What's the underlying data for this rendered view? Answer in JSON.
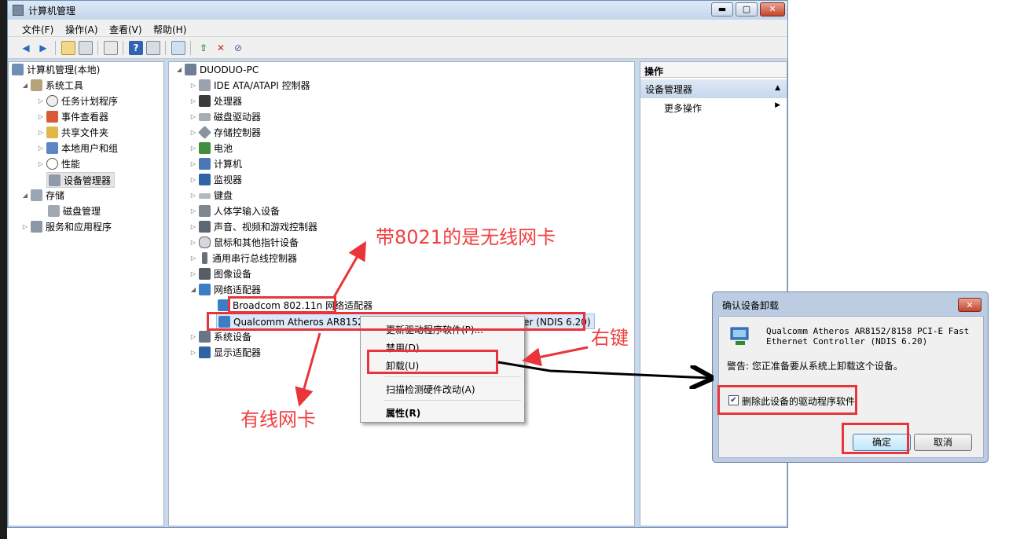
{
  "window": {
    "title": "计算机管理",
    "min_icon": "▬",
    "max_icon": "▢",
    "close_icon": "✕"
  },
  "menubar": [
    "文件(F)",
    "操作(A)",
    "查看(V)",
    "帮助(H)"
  ],
  "toolbar_icons": [
    "back-arrow-icon",
    "forward-arrow-icon",
    "up-folder-icon",
    "console-tree-icon",
    "properties-icon",
    "help-icon",
    "details-icon",
    "scan-icon",
    "update-driver-icon",
    "uninstall-icon",
    "disable-icon"
  ],
  "left_tree": {
    "root": "计算机管理(本地)",
    "system_tools": "系统工具",
    "items": [
      "任务计划程序",
      "事件查看器",
      "共享文件夹",
      "本地用户和组",
      "性能",
      "设备管理器"
    ],
    "storage": "存储",
    "disk": "磁盘管理",
    "services": "服务和应用程序"
  },
  "device_tree": {
    "root": "DUODUO-PC",
    "categories_a": [
      "IDE ATA/ATAPI 控制器",
      "处理器",
      "磁盘驱动器",
      "存储控制器",
      "电池",
      "计算机",
      "监视器",
      "键盘",
      "人体学输入设备",
      "声音、视频和游戏控制器",
      "鼠标和其他指针设备",
      "通用串行总线控制器",
      "图像设备"
    ],
    "network": "网络适配器",
    "wireless": "Broadcom 802.11n 网络适配器",
    "wired": "Qualcomm Atheros AR8152/8158 PCI-E Fast Ethernet Controller (NDIS 6.20)",
    "categories_b": [
      "系统设备",
      "显示适配器"
    ]
  },
  "actions": {
    "header": "操作",
    "section": "设备管理器",
    "more": "更多操作"
  },
  "context_menu": {
    "update": "更新驱动程序软件(P)...",
    "disable": "禁用(D)",
    "uninstall": "卸载(U)",
    "scan": "扫描检测硬件改动(A)",
    "properties": "属性(R)"
  },
  "dialog": {
    "title": "确认设备卸载",
    "device_line1": "Qualcomm Atheros AR8152/8158 PCI-E Fast",
    "device_line2": "Ethernet Controller (NDIS 6.20)",
    "warning": "警告: 您正准备要从系统上卸载这个设备。",
    "checkbox_label": "删除此设备的驱动程序软件",
    "checkbox_mark": "✔",
    "ok": "确定",
    "cancel": "取消"
  },
  "annotations": {
    "wireless_note": "带8021的是无线网卡",
    "wired_note": "有线网卡",
    "right_click_note": "右键"
  },
  "colors": {
    "annotation_red": "#e8343a"
  }
}
